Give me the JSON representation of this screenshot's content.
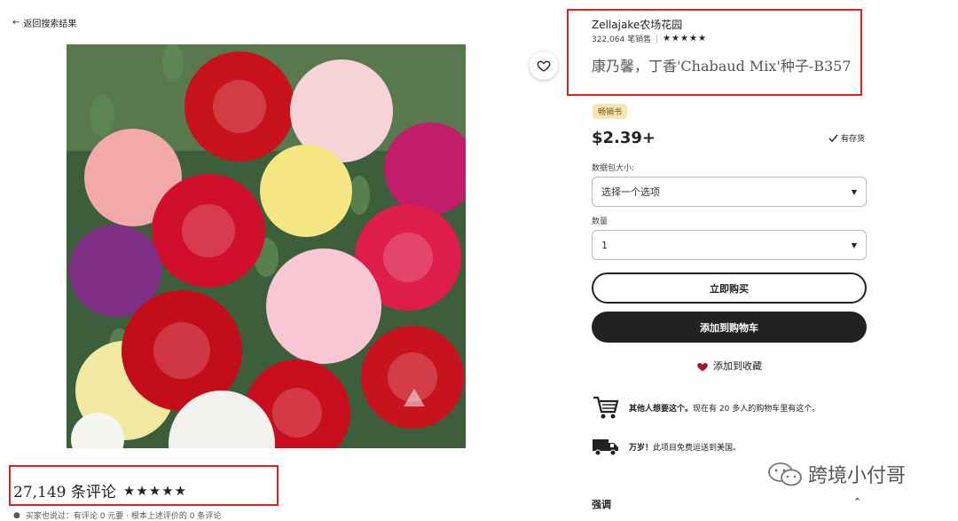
{
  "nav": {
    "back_label": "返回搜索结果"
  },
  "product": {
    "title": "康乃馨，丁香'Chabaud Mix'种子-B357",
    "review_count_label": "27,149 条评论",
    "review_stars": "★★★★★",
    "below_reviews_text": "买家也说过：有评论 0 元要 · 根本上述评价的 0 条评论"
  },
  "shop": {
    "name": "Zellajake农场花园",
    "sales": "322,064 笔销售",
    "stars": "★★★★★"
  },
  "badge": {
    "bestseller": "畅销书"
  },
  "price": {
    "value": "$2.39+",
    "stock": "有存货"
  },
  "options": {
    "size_label": "数据包大小:",
    "size_value": "选择一个选项",
    "qty_label": "数量",
    "qty_value": "1"
  },
  "actions": {
    "buy_now": "立即购买",
    "add_to_cart": "添加到购物车",
    "add_to_favorites": "添加到收藏"
  },
  "info": {
    "cart_bold": "其他人想要这个。",
    "cart_text": "现在有 20 多人的购物车里有这个。",
    "ship_bold": "万岁！",
    "ship_text": "此项目免费运送到美国。"
  },
  "section": {
    "emphasis": "强调"
  },
  "watermark": {
    "text": "跨境小付哥"
  },
  "icons": {
    "back": "arrow-left-icon",
    "favorite": "heart-outline-icon",
    "favorite_filled": "heart-icon",
    "check": "check-icon",
    "cart": "shopping-cart-icon",
    "truck": "delivery-truck-icon",
    "caret": "caret-down-icon",
    "chevron_up": "chevron-up-icon",
    "wechat": "wechat-icon"
  },
  "colors": {
    "annotation_red": "#e02020",
    "primary_dark": "#222222",
    "bestseller_bg": "#f7e6b3",
    "heart_red": "#a61a2c"
  }
}
